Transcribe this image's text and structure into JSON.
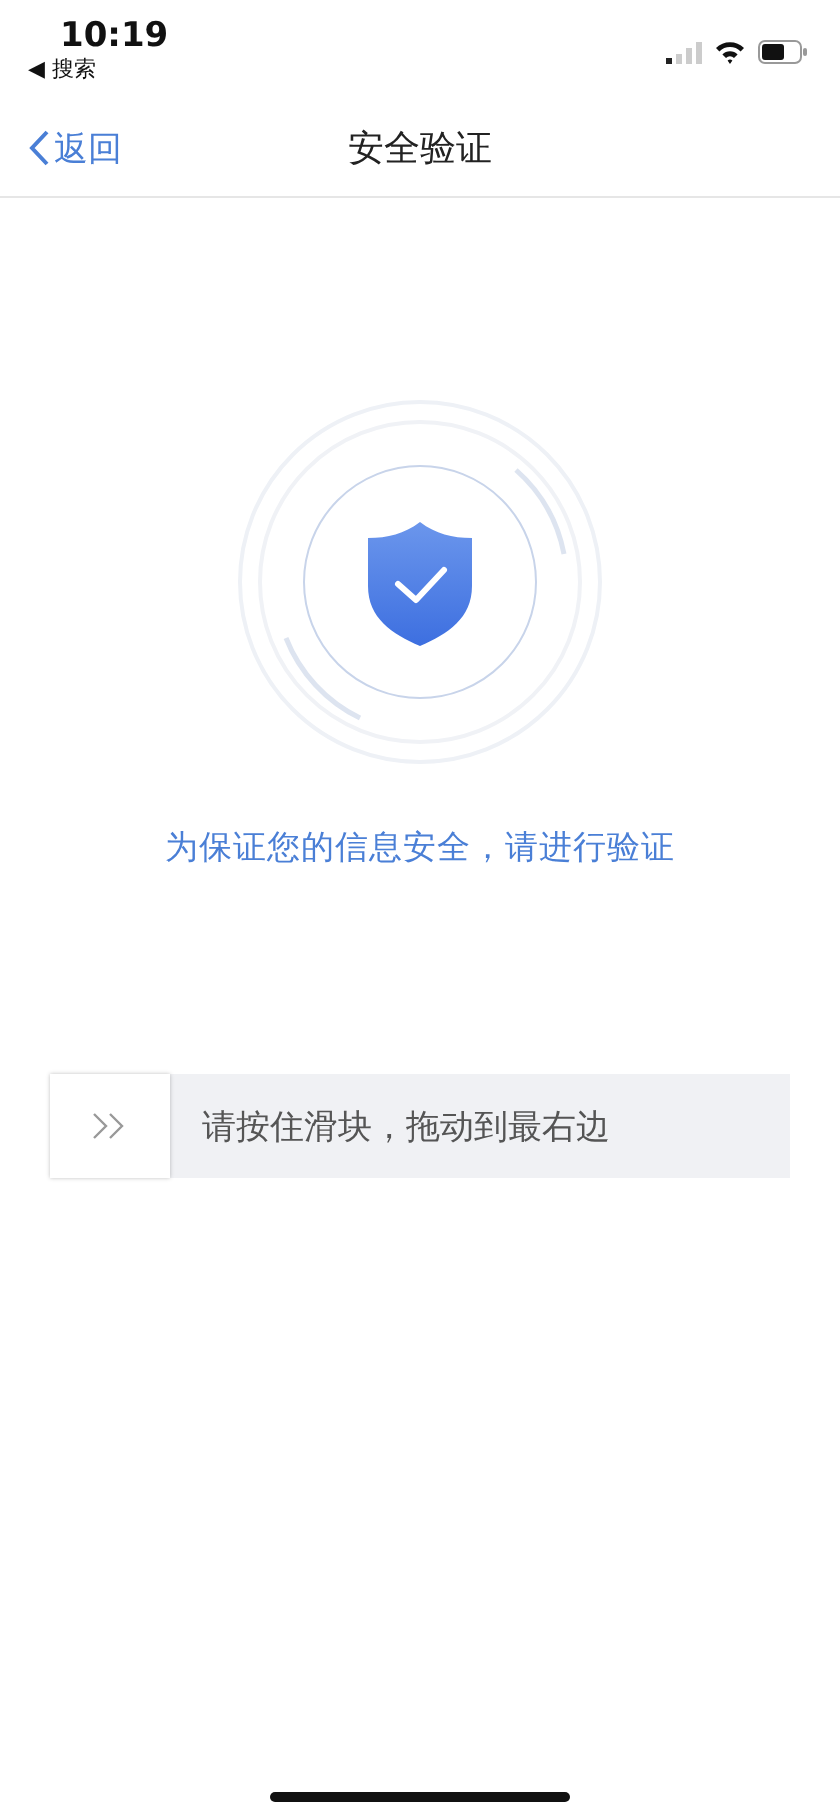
{
  "status_bar": {
    "time": "10:19",
    "back_app": "◀ 搜索"
  },
  "nav": {
    "back": "返回",
    "title": "安全验证"
  },
  "message": "为保证您的信息安全，请进行验证",
  "slider": {
    "hint": "请按住滑块，拖动到最右边",
    "level": 0
  }
}
